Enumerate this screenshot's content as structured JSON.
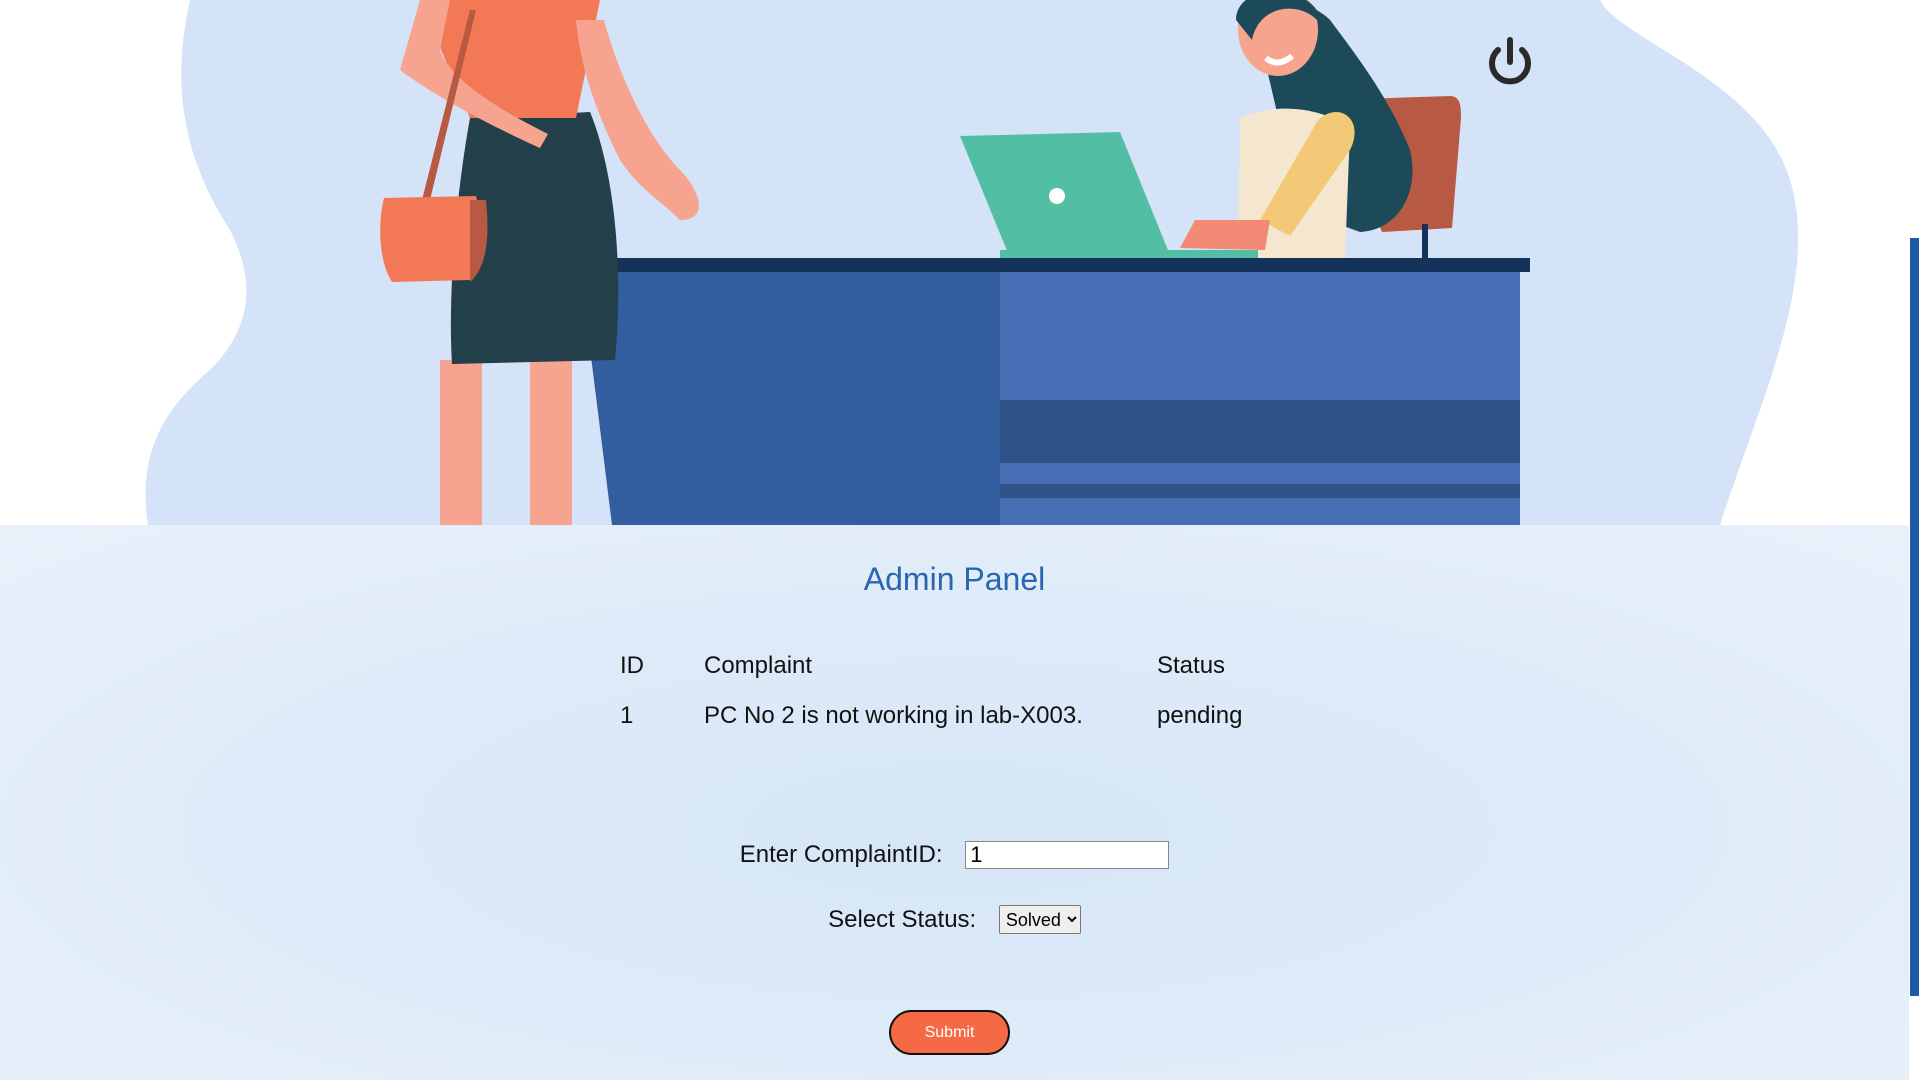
{
  "hero": {
    "illustration": "help-desk-illustration",
    "power_icon": "power-icon"
  },
  "panel": {
    "title": "Admin Panel"
  },
  "table": {
    "headers": {
      "id": "ID",
      "complaint": "Complaint",
      "status": "Status"
    },
    "rows": [
      {
        "id": "1",
        "complaint": "PC No 2 is not working in lab-X003.",
        "status": "pending"
      }
    ]
  },
  "form": {
    "complaint_id_label": "Enter ComplaintID:",
    "complaint_id_value": "1",
    "status_label": "Select Status:",
    "status_selected": "Solved",
    "submit_label": "Submit"
  },
  "colors": {
    "accent": "#f56a44",
    "title": "#2a66b0",
    "scrollbar": "#1d5ba8"
  }
}
